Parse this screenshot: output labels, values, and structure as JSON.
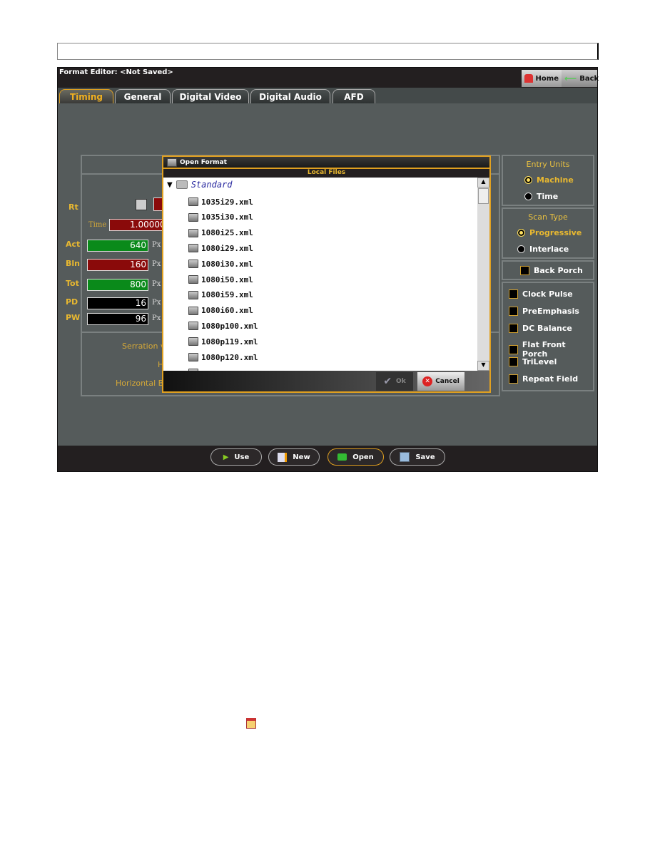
{
  "window": {
    "title": "Format Editor: <Not Saved>",
    "home_label": "Home",
    "back_label": "Back"
  },
  "tabs": [
    {
      "label": "Timing",
      "active": true
    },
    {
      "label": "General"
    },
    {
      "label": "Digital Video"
    },
    {
      "label": "Digital Audio"
    },
    {
      "label": "AFD"
    }
  ],
  "timing": {
    "rt_label": "Rt",
    "time_label": "Time",
    "time_value": "1.00000",
    "rows": [
      {
        "label": "Act",
        "value": "640",
        "unit": "Px",
        "color": "#0a8a1a"
      },
      {
        "label": "Bln",
        "value": "160",
        "unit": "Px",
        "color": "#8a0a0a"
      },
      {
        "label": "Tot",
        "value": "800",
        "unit": "Px",
        "color": "#0a8a1a"
      },
      {
        "label": "PD",
        "value": "16",
        "unit": "Px",
        "color": "#000000"
      },
      {
        "label": "PW",
        "value": "96",
        "unit": "Px",
        "color": "#000000"
      }
    ],
    "lower_labels": [
      "Serration v",
      "H",
      "Horizontal B"
    ]
  },
  "right_panel": {
    "entry_units": {
      "title": "Entry Units",
      "options": [
        {
          "label": "Machine",
          "selected": true
        },
        {
          "label": "Time",
          "selected": false
        }
      ]
    },
    "scan_type": {
      "title": "Scan Type",
      "options": [
        {
          "label": "Progressive",
          "selected": true
        },
        {
          "label": "Interlace",
          "selected": false
        }
      ]
    },
    "back_porch": {
      "label": "Back Porch",
      "checked": false
    },
    "checkboxes": [
      {
        "label": "Clock Pulse",
        "checked": false
      },
      {
        "label": "PreEmphasis",
        "checked": false
      },
      {
        "label": "DC Balance",
        "checked": false
      },
      {
        "label": "Flat Front Porch",
        "checked": false
      },
      {
        "label": "TriLevel",
        "checked": false
      },
      {
        "label": "Repeat Field",
        "checked": false
      }
    ]
  },
  "dialog": {
    "title": "Open Format",
    "section": "Local Files",
    "folder": "Standard",
    "files": [
      "1035i29.xml",
      "1035i30.xml",
      "1080i25.xml",
      "1080i29.xml",
      "1080i30.xml",
      "1080i50.xml",
      "1080i59.xml",
      "1080i60.xml",
      "1080p100.xml",
      "1080p119.xml",
      "1080p120.xml"
    ],
    "ok_label": "Ok",
    "cancel_label": "Cancel"
  },
  "bottom_buttons": [
    {
      "label": "Use",
      "icon": "play-icon"
    },
    {
      "label": "New",
      "icon": "new-file-icon"
    },
    {
      "label": "Open",
      "icon": "folder-open-icon",
      "selected": true
    },
    {
      "label": "Save",
      "icon": "floppy-save-icon"
    }
  ],
  "colors": {
    "accent": "#e0a020",
    "panel": "#555b5b",
    "dark": "#231f20"
  }
}
